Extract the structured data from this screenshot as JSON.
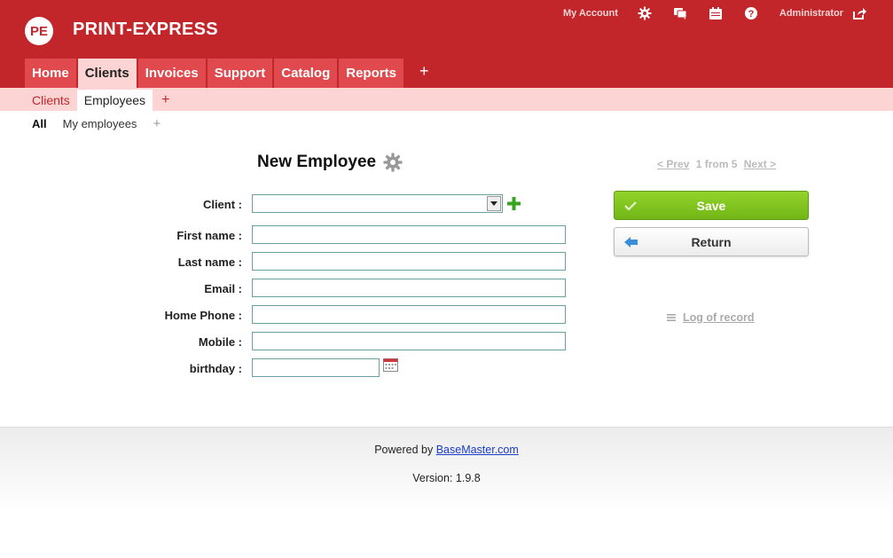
{
  "app": {
    "logo_text": "PE",
    "title": "PRINT-EXPRESS"
  },
  "top_links": {
    "my_account": "My Account",
    "user": "Administrator"
  },
  "main_tabs": [
    {
      "label": "Home"
    },
    {
      "label": "Clients"
    },
    {
      "label": "Invoices"
    },
    {
      "label": "Support"
    },
    {
      "label": "Catalog"
    },
    {
      "label": "Reports"
    }
  ],
  "main_tabs_add": "+",
  "sub_tabs": [
    {
      "label": "Clients"
    },
    {
      "label": "Employees"
    }
  ],
  "sub_tabs_add": "+",
  "filters": [
    {
      "label": "All"
    },
    {
      "label": "My employees"
    }
  ],
  "filters_add": "+",
  "form": {
    "title": "New Employee",
    "fields": {
      "client": {
        "label": "Client :",
        "value": ""
      },
      "first_name": {
        "label": "First name :",
        "value": ""
      },
      "last_name": {
        "label": "Last name :",
        "value": ""
      },
      "email": {
        "label": "Email :",
        "value": ""
      },
      "home_phone": {
        "label": "Home Phone :",
        "value": ""
      },
      "mobile": {
        "label": "Mobile :",
        "value": ""
      },
      "birthday": {
        "label": "birthday :",
        "value": ""
      }
    }
  },
  "pager": {
    "prev": "< Prev",
    "info": "1 from 5",
    "next": "Next >"
  },
  "actions": {
    "save": "Save",
    "return": "Return",
    "log": "Log of record"
  },
  "footer": {
    "powered_prefix": "Powered by",
    "powered_link": "BaseMaster.com",
    "version": "Version: 1.9.8"
  },
  "colors": {
    "brand": "#c3262a",
    "tab": "#e0494d",
    "tab_active": "#fdd4d4",
    "save": "#7cc021"
  }
}
